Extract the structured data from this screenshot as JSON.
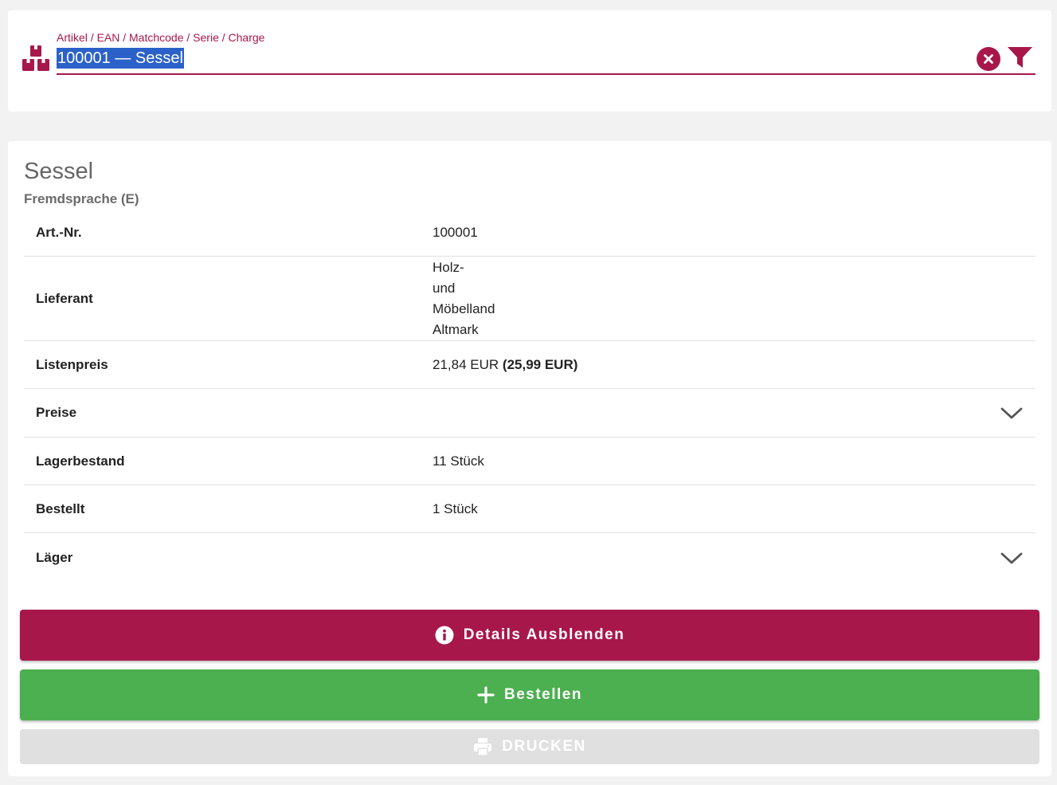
{
  "search": {
    "label": "Artikel / EAN / Matchcode / Serie / Charge",
    "value": "100001 — Sessel",
    "box_icon": "boxes-icon",
    "clear_icon": "clear-circle-icon",
    "filter_icon": "filter-icon"
  },
  "article": {
    "title": "Sessel",
    "subtitle": "Fremdsprache (E)",
    "rows": [
      {
        "label": "Art.-Nr.",
        "value": "100001"
      },
      {
        "label": "Lieferant",
        "value_lines": [
          "Holz-",
          "und",
          "Möbelland",
          "Altmark"
        ]
      },
      {
        "label": "Listenpreis",
        "value": "21,84 EUR",
        "value_bold": "(25,99 EUR)"
      },
      {
        "label": "Preise",
        "expandable": true
      },
      {
        "label": "Lagerbestand",
        "value": "11 Stück"
      },
      {
        "label": "Bestellt",
        "value": "1 Stück"
      },
      {
        "label": "Läger",
        "expandable": true
      }
    ]
  },
  "buttons": {
    "details": "Details Ausblenden",
    "order": "Bestellen",
    "print": "DRUCKEN"
  },
  "colors": {
    "primary": "#a8174a",
    "success": "#4caf50",
    "disabled": "#e0e0e0",
    "selection": "#2b61c9"
  }
}
